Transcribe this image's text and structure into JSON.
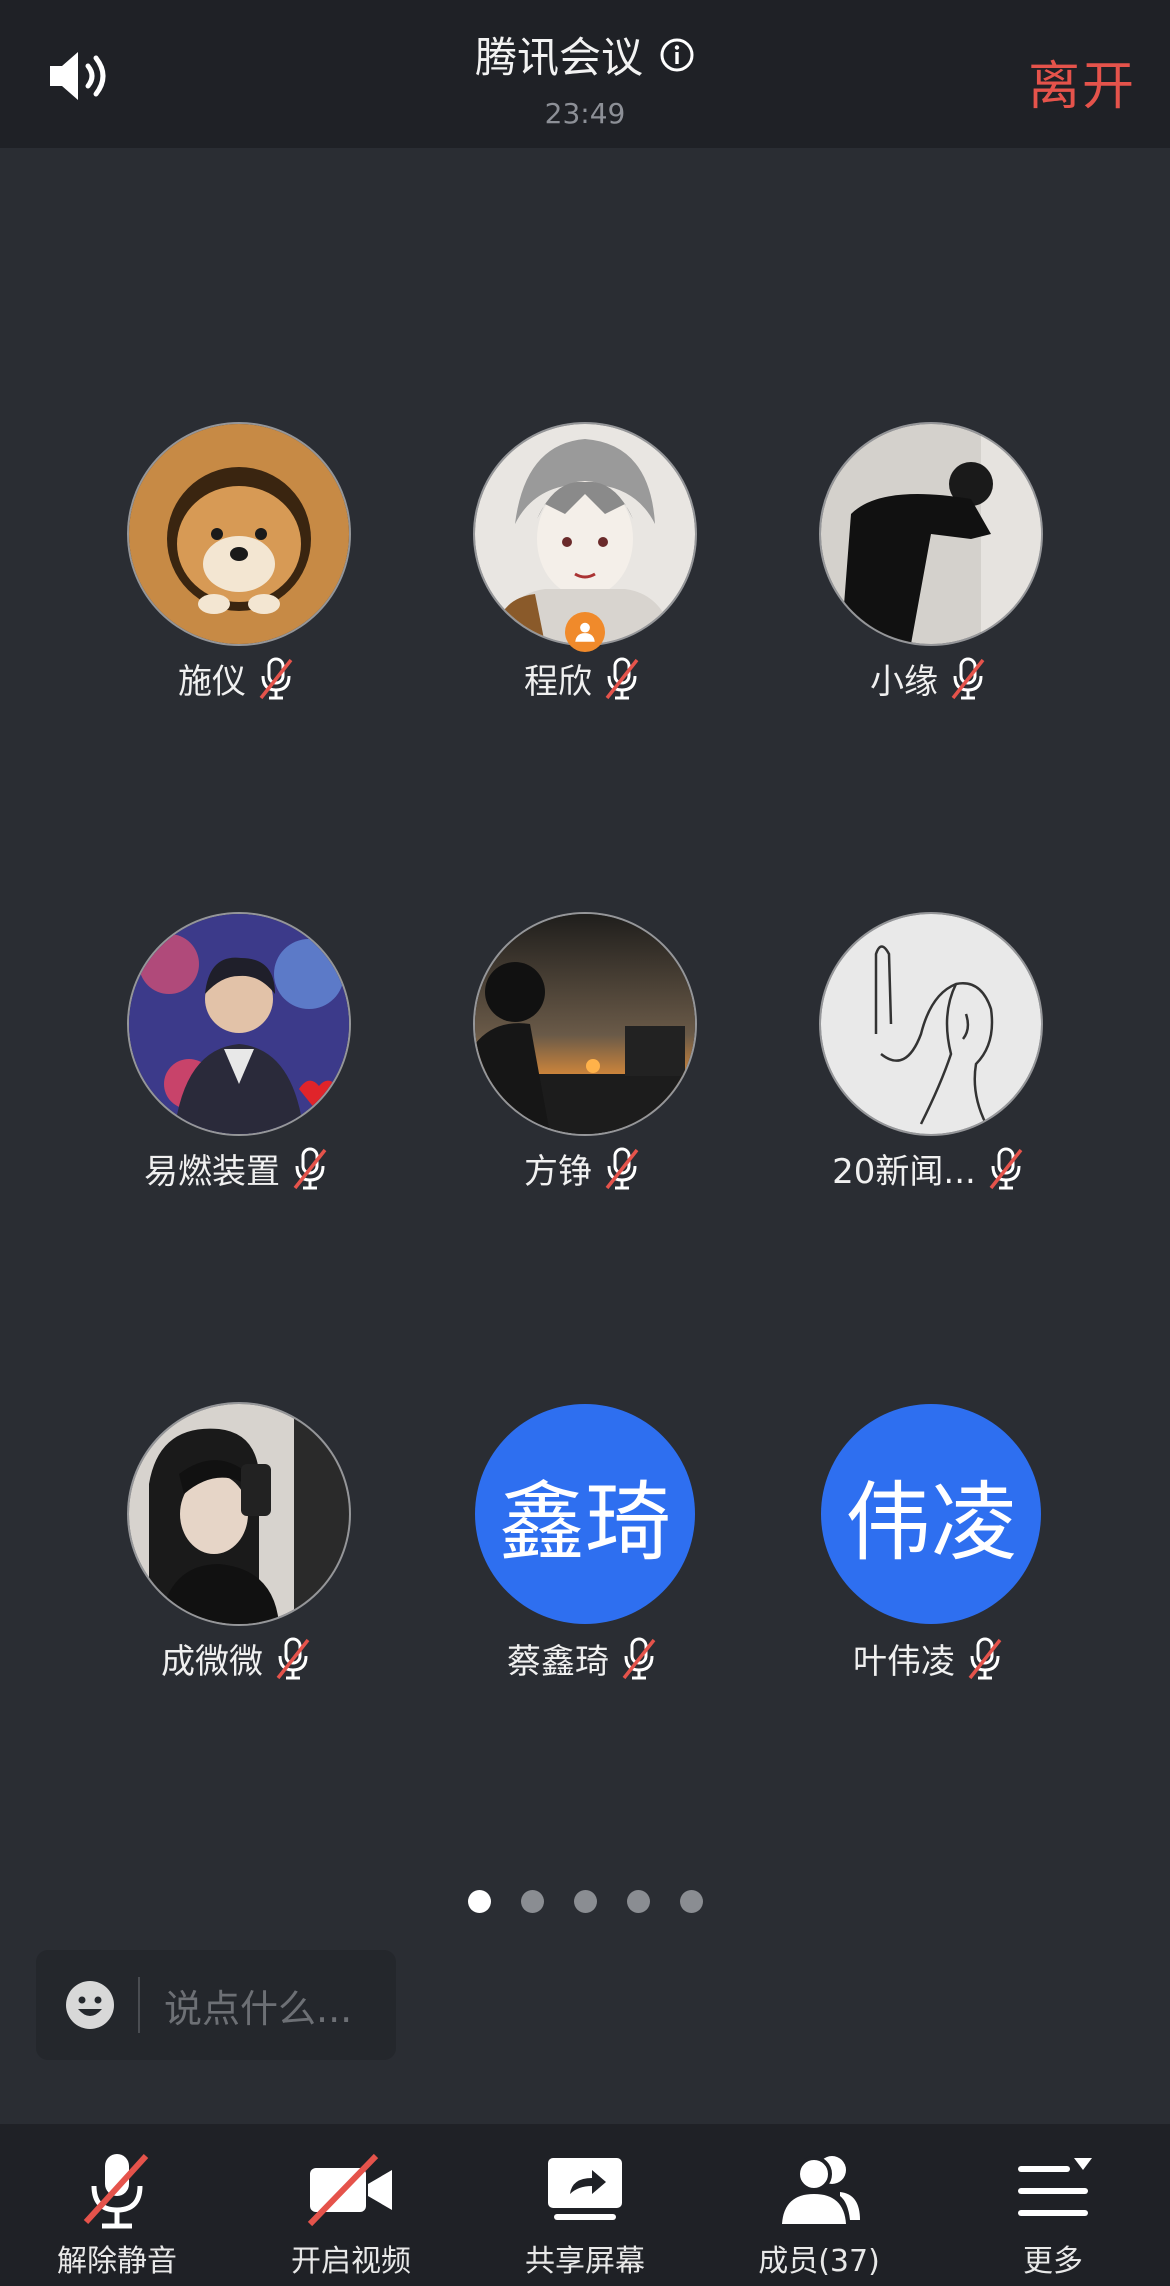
{
  "header": {
    "title": "腾讯会议",
    "time": "23:49",
    "leave_label": "离开"
  },
  "participants": [
    {
      "name": "施仪",
      "avatar": "shiba-dog-photo",
      "muted": true
    },
    {
      "name": "程欣",
      "avatar": "anime-boy-photo",
      "muted": true,
      "host": true
    },
    {
      "name": "小缘",
      "avatar": "person-leaning-photo",
      "muted": true
    },
    {
      "name": "易燃装置",
      "avatar": "young-man-photo",
      "muted": true
    },
    {
      "name": "方铮",
      "avatar": "sunset-silhouette-photo",
      "muted": true
    },
    {
      "name": "20新闻...",
      "avatar": "line-drawing-photo",
      "muted": true
    },
    {
      "name": "成微微",
      "avatar": "couple-selfie-photo",
      "muted": true
    },
    {
      "name": "蔡鑫琦",
      "avatar_text": "鑫琦",
      "muted": true
    },
    {
      "name": "叶伟凌",
      "avatar_text": "伟凌",
      "muted": true
    }
  ],
  "pagination": {
    "total": 5,
    "current": 1
  },
  "chat": {
    "placeholder": "说点什么..."
  },
  "toolbar": {
    "unmute": "解除静音",
    "video": "开启视频",
    "share": "共享屏幕",
    "members": "成员(37)",
    "more": "更多"
  },
  "colors": {
    "accent_blue": "#2e6ff0",
    "leave_red": "#e5534b",
    "host_orange": "#f08a2b",
    "background": "#2a2d33"
  }
}
